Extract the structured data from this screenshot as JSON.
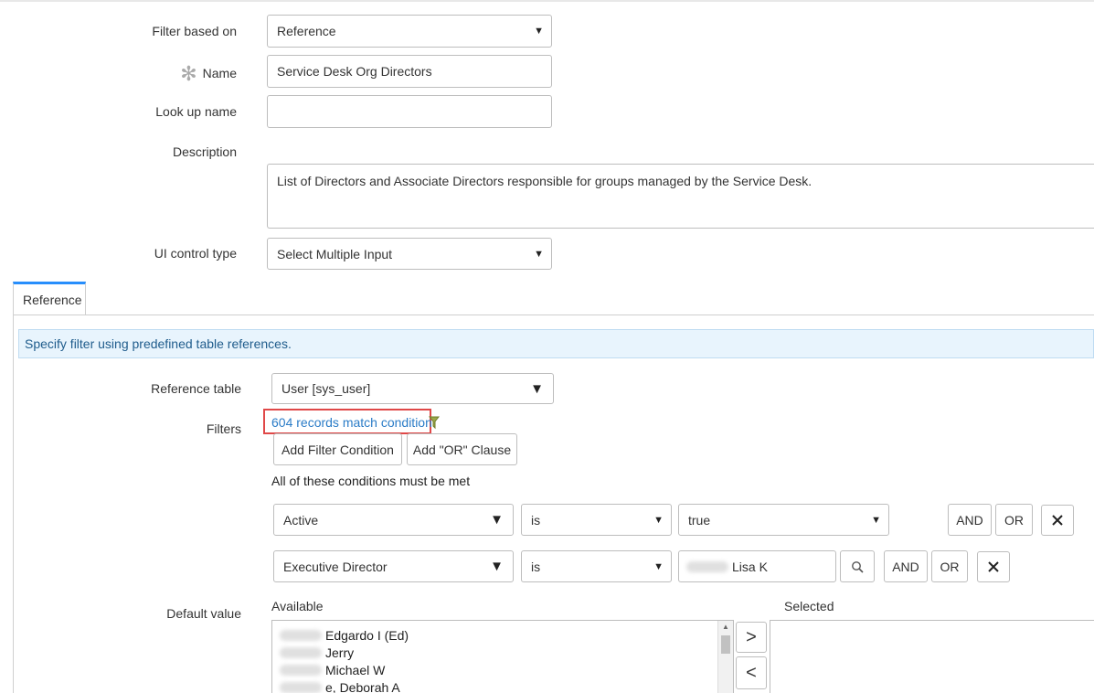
{
  "form": {
    "filter_based_on": {
      "label": "Filter based on",
      "value": "Reference"
    },
    "name": {
      "label": "Name",
      "value": "Service Desk Org Directors"
    },
    "lookup_name": {
      "label": "Look up name",
      "value": ""
    },
    "description": {
      "label": "Description",
      "value": "List of Directors and Associate Directors responsible for groups managed by the Service Desk."
    },
    "ui_control_type": {
      "label": "UI control type",
      "value": "Select Multiple Input"
    }
  },
  "tabs": [
    {
      "label": "Reference"
    }
  ],
  "reference": {
    "info": "Specify filter using predefined table references.",
    "reference_table": {
      "label": "Reference table",
      "value": "User [sys_user]"
    },
    "filters_label": "Filters",
    "records_link": "604 records match condition",
    "add_filter_button": "Add Filter Condition",
    "add_or_button": "Add \"OR\" Clause",
    "conditions_heading": "All of these conditions must be met",
    "conditions": [
      {
        "field": "Active",
        "operator": "is",
        "value": "true",
        "and": "AND",
        "or": "OR"
      },
      {
        "field": "Executive Director",
        "operator": "is",
        "value": "Lisa K",
        "and": "AND",
        "or": "OR"
      }
    ],
    "default_value": {
      "label": "Default value",
      "available_label": "Available",
      "selected_label": "Selected",
      "available_items": [
        "Edgardo I (Ed)",
        "Jerry",
        "Michael W",
        "e, Deborah A"
      ]
    },
    "add_arrow": ">",
    "remove_arrow": "<"
  },
  "icons": {
    "required": "asterisk-icon",
    "dropdown": "caret-down-icon",
    "search": "search-icon",
    "remove": "close-icon",
    "filter": "filter-icon"
  },
  "colors": {
    "accent": "#278efc",
    "link": "#2b7cc7",
    "highlight": "#e04848",
    "info_bg": "#e8f4fd"
  }
}
